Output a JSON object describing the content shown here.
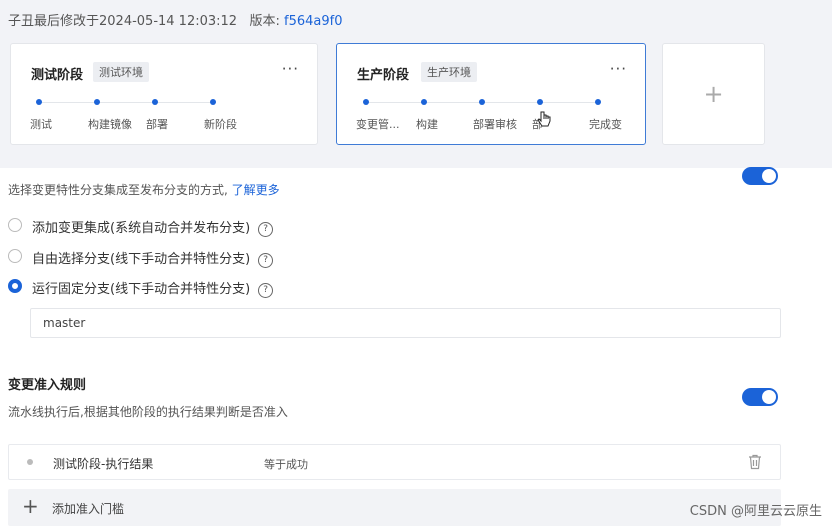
{
  "header": {
    "modified_text": "子丑最后修改于2024-05-14 12:03:12",
    "version_label": "版本:",
    "version_value": "f564a9f0"
  },
  "stages": [
    {
      "title": "测试阶段",
      "tag": "测试环境",
      "more": "···",
      "steps": [
        "测试",
        "构建镜像",
        "部署",
        "新阶段"
      ]
    },
    {
      "title": "生产阶段",
      "tag": "生产环境",
      "more": "···",
      "steps": [
        "变更管...",
        "构建",
        "部署审核",
        "部",
        "完成变"
      ]
    }
  ],
  "add_stage": {
    "symbol": "+"
  },
  "integration": {
    "description": "选择变更特性分支集成至发布分支的方式,",
    "learn_more": "了解更多",
    "enabled": true,
    "options": [
      {
        "label": "添加变更集成(系统自动合并发布分支)",
        "checked": false
      },
      {
        "label": "自由选择分支(线下手动合并特性分支)",
        "checked": false
      },
      {
        "label": "运行固定分支(线下手动合并特性分支)",
        "checked": true
      }
    ],
    "branch_value": "master"
  },
  "admission": {
    "title": "变更准入规则",
    "description": "流水线执行后,根据其他阶段的执行结果判断是否准入",
    "enabled": true,
    "rules": [
      {
        "name": "测试阶段-执行结果",
        "condition": "等于成功"
      }
    ],
    "add_label": "添加准入门槛",
    "add_symbol": "+"
  },
  "help_symbol": "?",
  "watermark": "CSDN @阿里云云原生",
  "colors": {
    "accent": "#1b63d8",
    "band": "#f2f3f7"
  }
}
